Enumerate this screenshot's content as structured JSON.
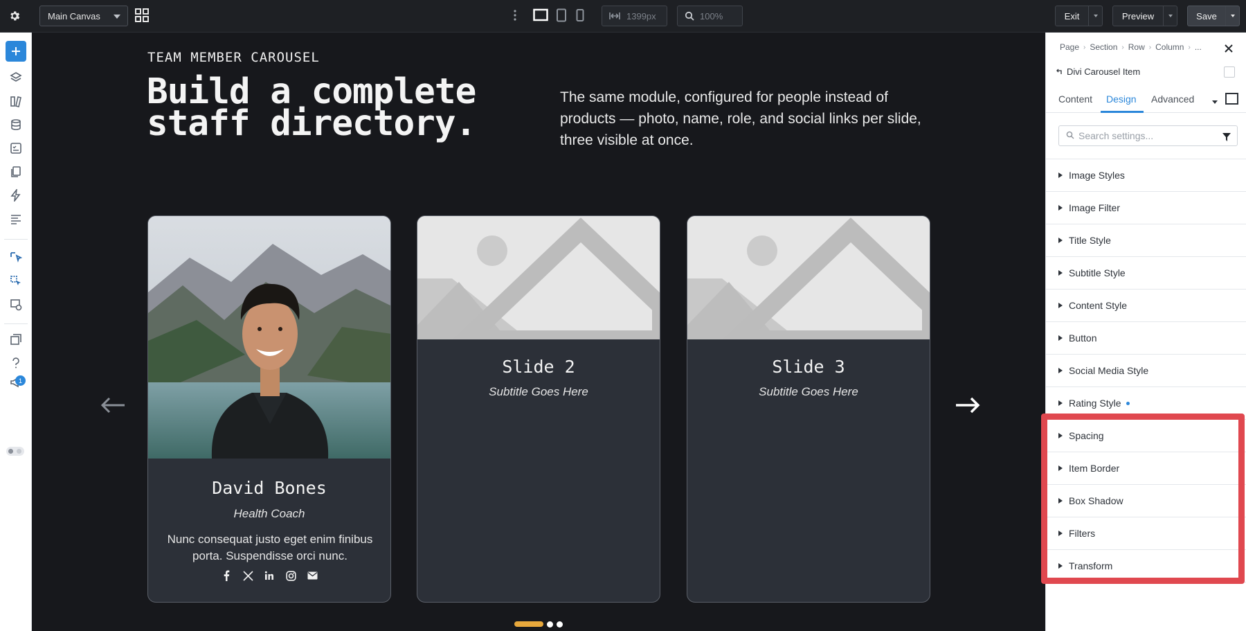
{
  "toolbar": {
    "canvas_select": "Main Canvas",
    "width_value": "1399px",
    "zoom_value": "100%",
    "exit_label": "Exit",
    "preview_label": "Preview",
    "save_label": "Save"
  },
  "rail": {
    "badge_count": "1"
  },
  "canvas": {
    "eyebrow": "TEAM MEMBER CAROUSEL",
    "headline": "Build a complete staff directory.",
    "lede": "The same module, configured for people instead of products — photo, name, role, and social links per slide, three visible at once.",
    "cards": [
      {
        "title": "David Bones",
        "subtitle": "Health Coach",
        "body": "Nunc consequat justo eget enim finibus porta. Suspendisse orci nunc."
      },
      {
        "title": "Slide 2",
        "subtitle": "Subtitle Goes Here"
      },
      {
        "title": "Slide 3",
        "subtitle": "Subtitle Goes Here"
      }
    ],
    "accent_color": "#e7a83c"
  },
  "panel": {
    "breadcrumbs": [
      "Page",
      "Section",
      "Row",
      "Column",
      "..."
    ],
    "item_title": "Divi Carousel Item",
    "tabs": [
      "Content",
      "Design",
      "Advanced"
    ],
    "active_tab": "Design",
    "search_placeholder": "Search settings...",
    "groups": [
      "Image Styles",
      "Image Filter",
      "Title Style",
      "Subtitle Style",
      "Content Style",
      "Button",
      "Social Media Style",
      "Rating Style",
      "Spacing",
      "Item Border",
      "Box Shadow",
      "Filters",
      "Transform"
    ],
    "accent_color": "#2b87da",
    "highlight_color": "#e0484f"
  }
}
